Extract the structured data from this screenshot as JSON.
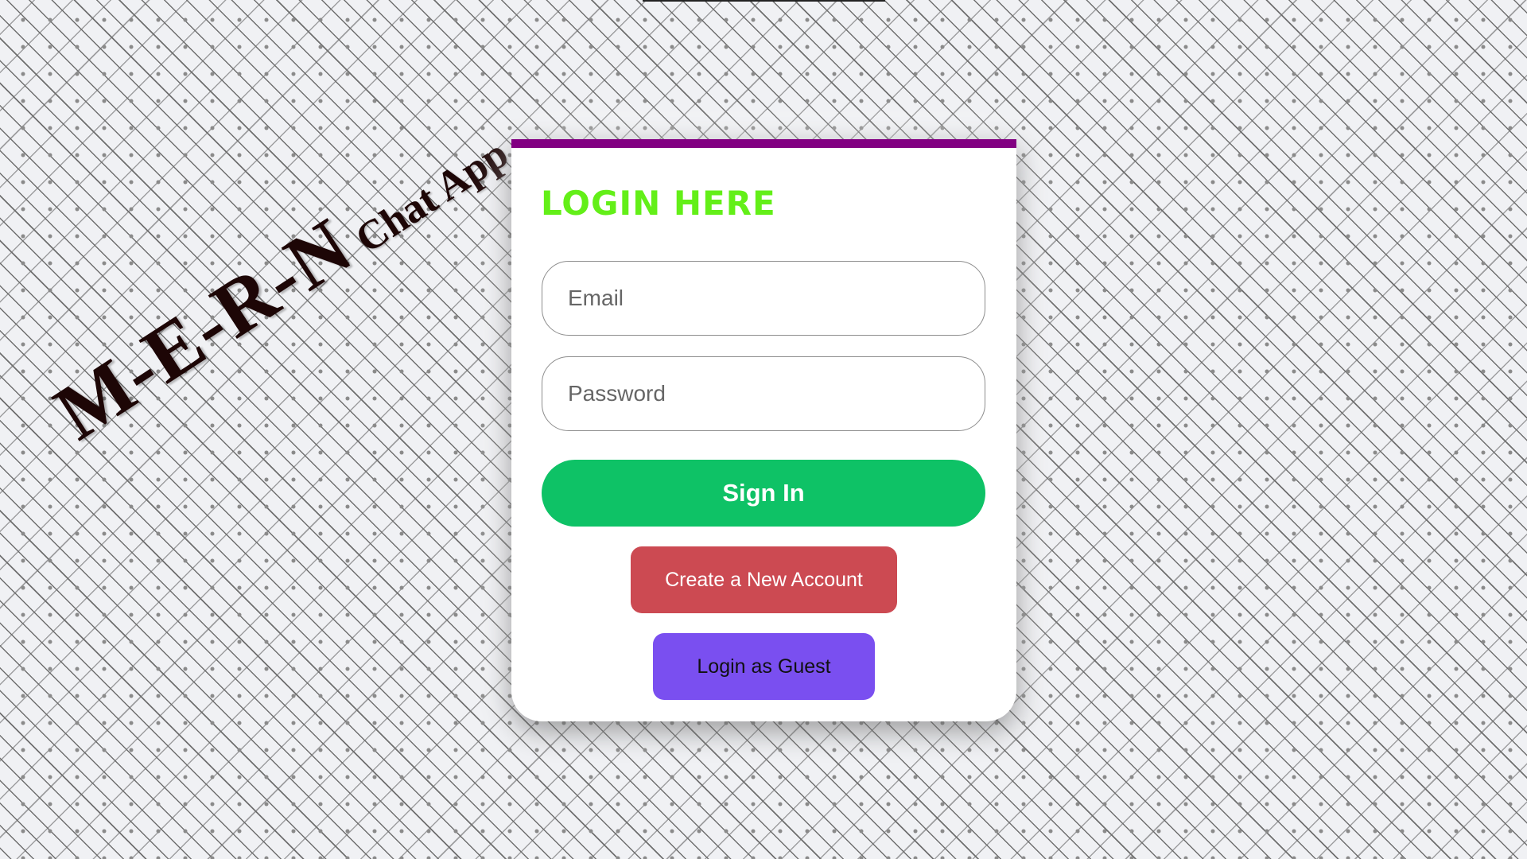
{
  "background": {
    "brand_primary": "M-E-R-N",
    "brand_secondary": "Chat App"
  },
  "login": {
    "title": "LOGIN HERE",
    "email_placeholder": "Email",
    "password_placeholder": "Password",
    "sign_in_label": "Sign In",
    "create_account_label": "Create a New Account",
    "guest_label": "Login as Guest"
  },
  "colors": {
    "card_accent": "#820082",
    "title": "#63ef18",
    "sign_in": "#0ec266",
    "create_account": "#cc4a52",
    "guest": "#7a4ff0"
  }
}
